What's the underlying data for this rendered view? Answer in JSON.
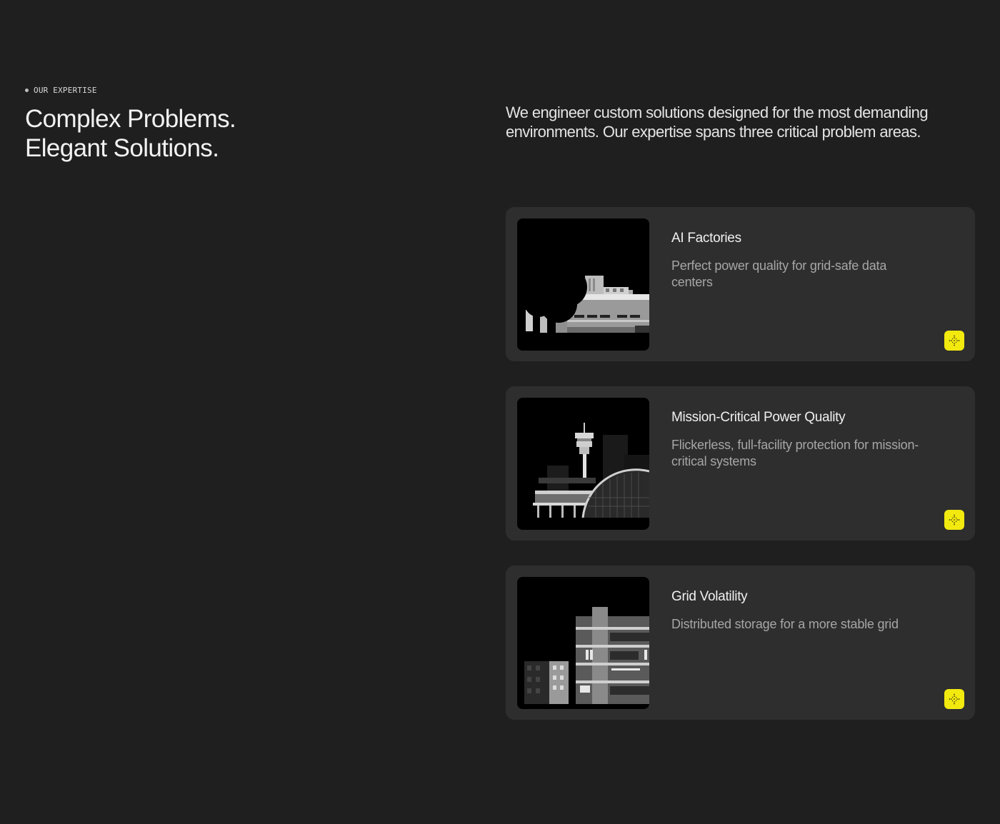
{
  "section": {
    "eyebrow": "OUR EXPERTISE",
    "headline_line1": "Complex Problems.",
    "headline_line2": "Elegant Solutions.",
    "intro": "We engineer custom solutions designed for the most demanding environments. Our expertise spans three critical problem areas."
  },
  "cards": [
    {
      "title": "AI Factories",
      "description": "Perfect power quality for grid-safe data centers",
      "illustration": "data-center-building-illustration",
      "action_icon": "crosshair-dots-icon"
    },
    {
      "title": "Mission-Critical Power Quality",
      "description": "Flickerless, full-facility protection for mission-critical systems",
      "illustration": "airport-tower-illustration",
      "action_icon": "crosshair-dots-icon"
    },
    {
      "title": "Grid Volatility",
      "description": "Distributed storage for a more stable grid",
      "illustration": "apartment-buildings-illustration",
      "action_icon": "crosshair-dots-icon"
    }
  ],
  "colors": {
    "background": "#1f1f1f",
    "card": "#2e2e2e",
    "accent": "#f2e90f"
  }
}
